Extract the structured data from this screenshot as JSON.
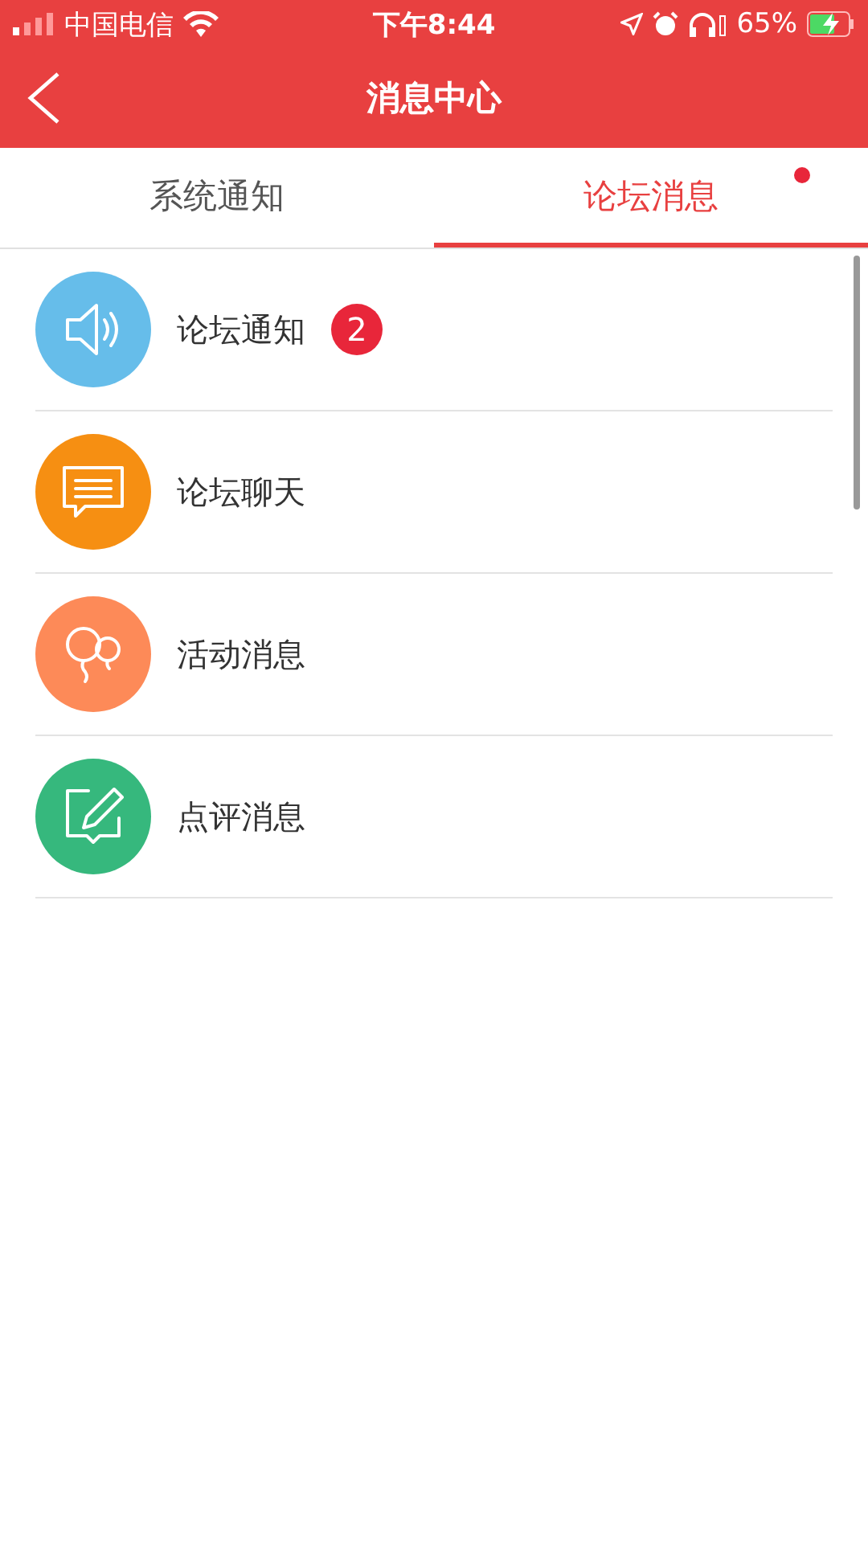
{
  "status_bar": {
    "carrier": "中国电信",
    "time": "下午8:44",
    "battery": "65%"
  },
  "nav": {
    "title": "消息中心"
  },
  "tabs": [
    {
      "label": "系统通知",
      "selected": false,
      "dot": false
    },
    {
      "label": "论坛消息",
      "selected": true,
      "dot": true
    }
  ],
  "items": [
    {
      "label": "论坛通知",
      "kind": "speaker",
      "color": "#66bdea",
      "badge": "2"
    },
    {
      "label": "论坛聊天",
      "kind": "chat",
      "color": "#f68f12"
    },
    {
      "label": "活动消息",
      "kind": "balloon",
      "color": "#fd8a58"
    },
    {
      "label": "点评消息",
      "kind": "review",
      "color": "#36b87d"
    }
  ]
}
